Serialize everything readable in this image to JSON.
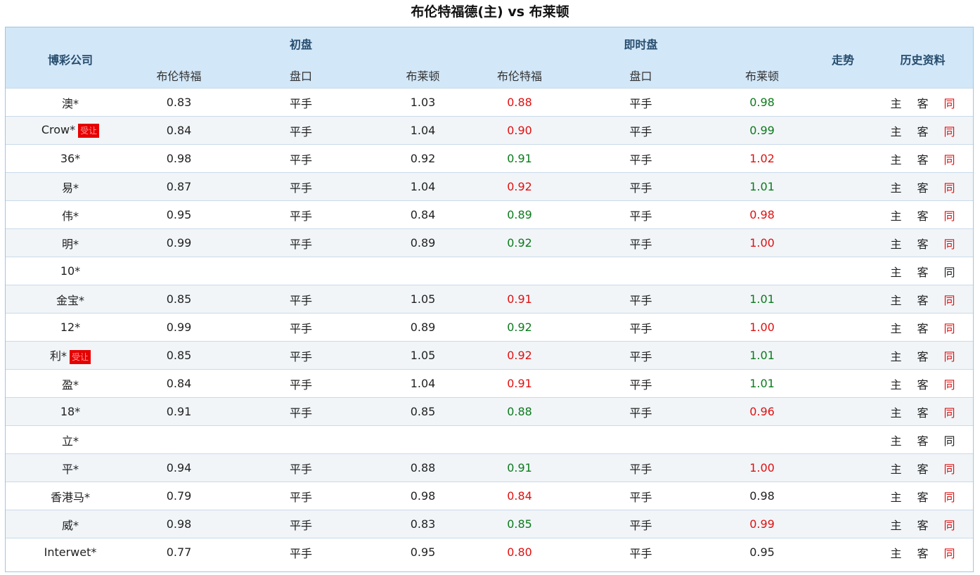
{
  "title": "布伦特福德(主) vs 布莱顿",
  "header": {
    "company": "博彩公司",
    "initial": "初盘",
    "live": "即时盘",
    "trend": "走势",
    "history": "历史资料",
    "home": "布伦特福",
    "handicap": "盘口",
    "away": "布莱顿"
  },
  "history_labels": {
    "home": "主",
    "away": "客",
    "same": "同"
  },
  "rows": [
    {
      "company": "澳*",
      "badge": "",
      "i_home": "0.83",
      "i_line": "平手",
      "i_away": "1.03",
      "l_home": "0.88",
      "l_home_c": "red",
      "l_line": "平手",
      "l_away": "0.98",
      "l_away_c": "green",
      "same_red": true
    },
    {
      "company": "Crow*",
      "badge": "受让",
      "i_home": "0.84",
      "i_line": "平手",
      "i_away": "1.04",
      "l_home": "0.90",
      "l_home_c": "red",
      "l_line": "平手",
      "l_away": "0.99",
      "l_away_c": "green",
      "same_red": true
    },
    {
      "company": "36*",
      "badge": "",
      "i_home": "0.98",
      "i_line": "平手",
      "i_away": "0.92",
      "l_home": "0.91",
      "l_home_c": "green",
      "l_line": "平手",
      "l_away": "1.02",
      "l_away_c": "red",
      "same_red": true
    },
    {
      "company": "易*",
      "badge": "",
      "i_home": "0.87",
      "i_line": "平手",
      "i_away": "1.04",
      "l_home": "0.92",
      "l_home_c": "red",
      "l_line": "平手",
      "l_away": "1.01",
      "l_away_c": "green",
      "same_red": true
    },
    {
      "company": "伟*",
      "badge": "",
      "i_home": "0.95",
      "i_line": "平手",
      "i_away": "0.84",
      "l_home": "0.89",
      "l_home_c": "green",
      "l_line": "平手",
      "l_away": "0.98",
      "l_away_c": "red",
      "same_red": true
    },
    {
      "company": "明*",
      "badge": "",
      "i_home": "0.99",
      "i_line": "平手",
      "i_away": "0.89",
      "l_home": "0.92",
      "l_home_c": "green",
      "l_line": "平手",
      "l_away": "1.00",
      "l_away_c": "red",
      "same_red": true
    },
    {
      "company": "10*",
      "badge": "",
      "i_home": "",
      "i_line": "",
      "i_away": "",
      "l_home": "",
      "l_home_c": "black",
      "l_line": "",
      "l_away": "",
      "l_away_c": "black",
      "same_red": false
    },
    {
      "company": "金宝*",
      "badge": "",
      "i_home": "0.85",
      "i_line": "平手",
      "i_away": "1.05",
      "l_home": "0.91",
      "l_home_c": "red",
      "l_line": "平手",
      "l_away": "1.01",
      "l_away_c": "green",
      "same_red": true
    },
    {
      "company": "12*",
      "badge": "",
      "i_home": "0.99",
      "i_line": "平手",
      "i_away": "0.89",
      "l_home": "0.92",
      "l_home_c": "green",
      "l_line": "平手",
      "l_away": "1.00",
      "l_away_c": "red",
      "same_red": true
    },
    {
      "company": "利*",
      "badge": "受让",
      "i_home": "0.85",
      "i_line": "平手",
      "i_away": "1.05",
      "l_home": "0.92",
      "l_home_c": "red",
      "l_line": "平手",
      "l_away": "1.01",
      "l_away_c": "green",
      "same_red": true
    },
    {
      "company": "盈*",
      "badge": "",
      "i_home": "0.84",
      "i_line": "平手",
      "i_away": "1.04",
      "l_home": "0.91",
      "l_home_c": "red",
      "l_line": "平手",
      "l_away": "1.01",
      "l_away_c": "green",
      "same_red": true
    },
    {
      "company": "18*",
      "badge": "",
      "i_home": "0.91",
      "i_line": "平手",
      "i_away": "0.85",
      "l_home": "0.88",
      "l_home_c": "green",
      "l_line": "平手",
      "l_away": "0.96",
      "l_away_c": "red",
      "same_red": true
    },
    {
      "company": "立*",
      "badge": "",
      "i_home": "",
      "i_line": "",
      "i_away": "",
      "l_home": "",
      "l_home_c": "black",
      "l_line": "",
      "l_away": "",
      "l_away_c": "black",
      "same_red": false
    },
    {
      "company": "平*",
      "badge": "",
      "i_home": "0.94",
      "i_line": "平手",
      "i_away": "0.88",
      "l_home": "0.91",
      "l_home_c": "green",
      "l_line": "平手",
      "l_away": "1.00",
      "l_away_c": "red",
      "same_red": true
    },
    {
      "company": "香港马*",
      "badge": "",
      "i_home": "0.79",
      "i_line": "平手",
      "i_away": "0.98",
      "l_home": "0.84",
      "l_home_c": "red",
      "l_line": "平手",
      "l_away": "0.98",
      "l_away_c": "black",
      "same_red": true
    },
    {
      "company": "威*",
      "badge": "",
      "i_home": "0.98",
      "i_line": "平手",
      "i_away": "0.83",
      "l_home": "0.85",
      "l_home_c": "green",
      "l_line": "平手",
      "l_away": "0.99",
      "l_away_c": "red",
      "same_red": true
    },
    {
      "company": "Interwet*",
      "badge": "",
      "i_home": "0.77",
      "i_line": "平手",
      "i_away": "0.95",
      "l_home": "0.80",
      "l_home_c": "red",
      "l_line": "平手",
      "l_away": "0.95",
      "l_away_c": "black",
      "same_red": true
    }
  ]
}
